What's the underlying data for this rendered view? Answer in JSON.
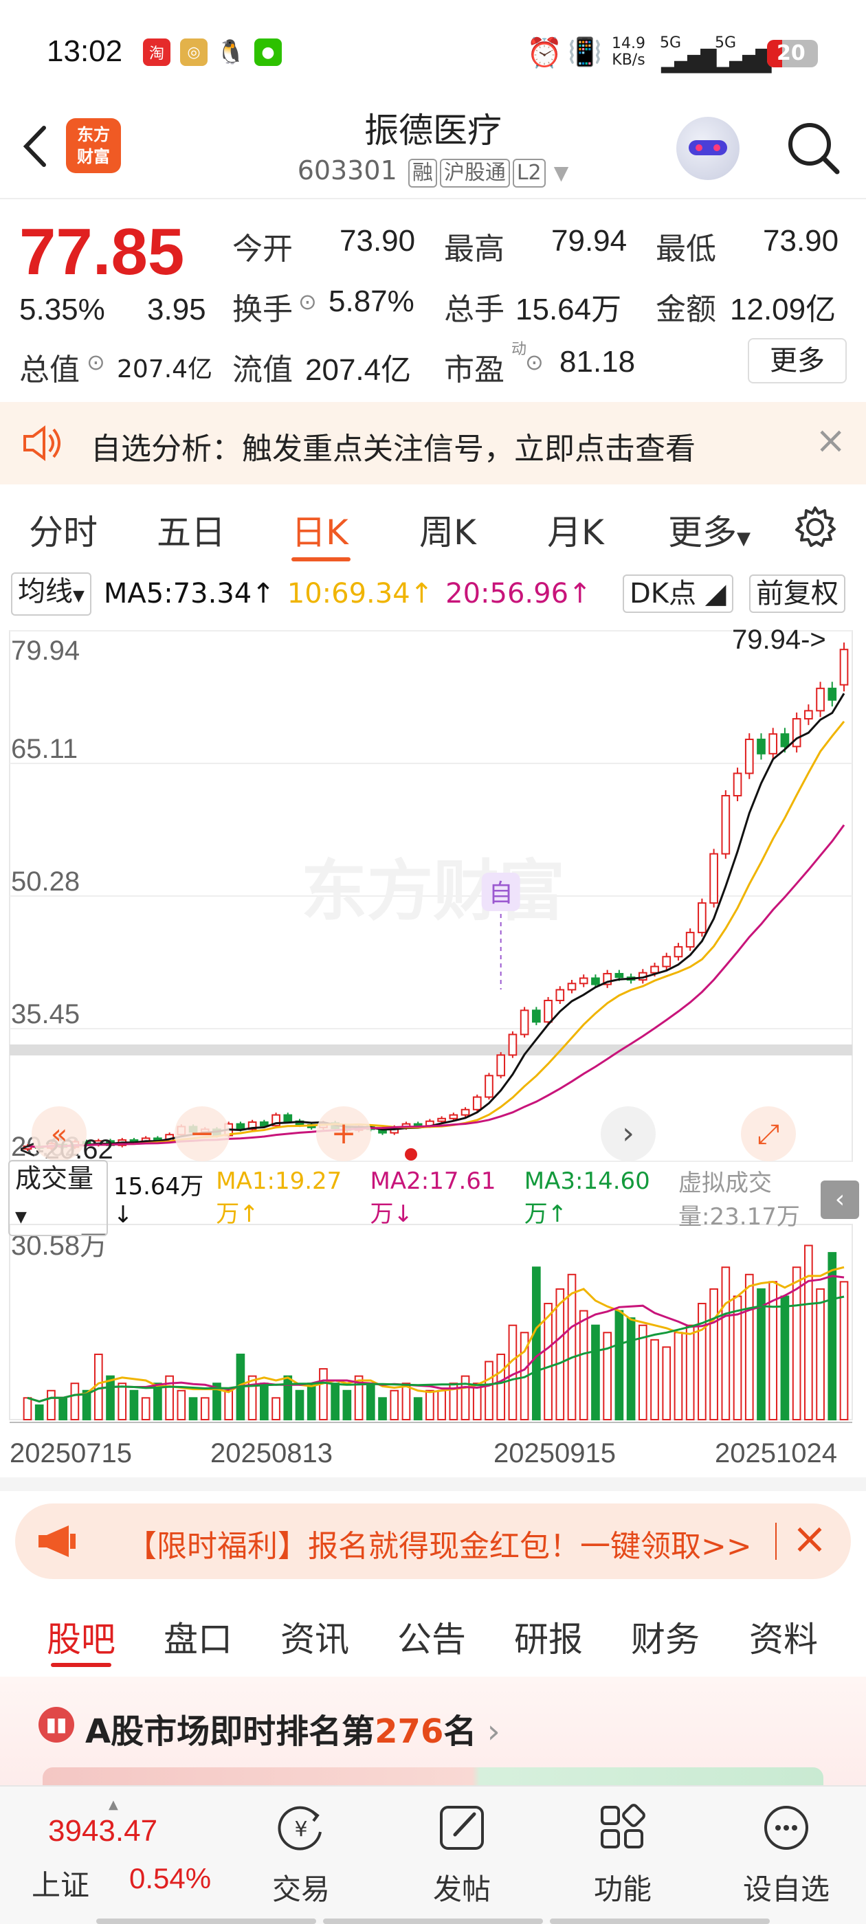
{
  "status_bar": {
    "time": "13:02",
    "net_speed": "14.9",
    "net_unit": "KB/s",
    "sig1": "5G",
    "sig2": "5G",
    "battery": "20"
  },
  "header": {
    "logo_text": "东方财富",
    "title": "振德医疗",
    "code": "603301",
    "tags": [
      "融",
      "沪股通",
      "L2"
    ]
  },
  "quote": {
    "price": "77.85",
    "change_pct": "5.35%",
    "change": "3.95",
    "fields": {
      "open_label": "今开",
      "open": "73.90",
      "high_label": "最高",
      "high": "79.94",
      "low_label": "最低",
      "low": "73.90",
      "turnover_label": "换手",
      "turnover": "5.87%",
      "volume_label": "总手",
      "volume": "15.64万",
      "amount_label": "金额",
      "amount": "12.09亿",
      "mktcap_label": "总值",
      "mktcap": "207.4亿",
      "float_label": "流值",
      "float": "207.4亿",
      "pe_label": "市盈",
      "pe_sup": "动",
      "pe": "81.18"
    },
    "more_label": "更多"
  },
  "alert": {
    "text": "自选分析：触发重点关注信号，立即点击查看"
  },
  "ktabs": [
    "分时",
    "五日",
    "日K",
    "周K",
    "月K",
    "更多"
  ],
  "ktab_active": 2,
  "ma_bar": {
    "ma_select": "均线",
    "ma5": "MA5:73.34",
    "ma10": "10:69.34",
    "ma20": "20:56.96",
    "dk": "DK点",
    "adjust": "前复权"
  },
  "colors": {
    "accent": "#f05a24",
    "up": "#e02020",
    "down": "#139a3c",
    "ma5": "#111111",
    "ma10": "#f0b400",
    "ma20": "#c8147a"
  },
  "chart_data": {
    "type": "candlestick",
    "y_ticks": [
      "79.94",
      "65.11",
      "50.28",
      "35.45",
      "20.62"
    ],
    "ylim": [
      20.62,
      79.94
    ],
    "high_marker": "79.94->",
    "low_marker": "<-20.62",
    "watermark": "东方财富",
    "zi_marker": "自",
    "x_labels": [
      "20250715",
      "20250813",
      "20250915",
      "20251024"
    ],
    "candles": [
      [
        22.0,
        22.3
      ],
      [
        22.3,
        22.1
      ],
      [
        22.1,
        22.6
      ],
      [
        22.5,
        22.2
      ],
      [
        22.2,
        22.8
      ],
      [
        22.8,
        22.5
      ],
      [
        22.5,
        22.9
      ],
      [
        22.9,
        22.4
      ],
      [
        22.4,
        23.0
      ],
      [
        23.0,
        22.8
      ],
      [
        22.8,
        23.2
      ],
      [
        23.2,
        22.9
      ],
      [
        22.9,
        23.6
      ],
      [
        23.6,
        24.5
      ],
      [
        24.5,
        23.9
      ],
      [
        23.9,
        24.2
      ],
      [
        24.2,
        23.5
      ],
      [
        23.5,
        24.8
      ],
      [
        24.8,
        24.2
      ],
      [
        24.2,
        25.0
      ],
      [
        25.0,
        24.6
      ],
      [
        24.6,
        25.8
      ],
      [
        25.8,
        25.1
      ],
      [
        25.1,
        24.7
      ],
      [
        24.7,
        24.4
      ],
      [
        24.4,
        24.9
      ],
      [
        24.9,
        24.3
      ],
      [
        24.3,
        24.1
      ],
      [
        24.1,
        24.5
      ],
      [
        24.5,
        24.2
      ],
      [
        24.2,
        23.8
      ],
      [
        23.8,
        24.4
      ],
      [
        24.4,
        24.8
      ],
      [
        24.8,
        24.6
      ],
      [
        24.6,
        25.1
      ],
      [
        25.1,
        25.4
      ],
      [
        25.4,
        25.8
      ],
      [
        25.8,
        26.4
      ],
      [
        26.4,
        27.8
      ],
      [
        27.8,
        30.2
      ],
      [
        30.2,
        32.5
      ],
      [
        32.5,
        34.8
      ],
      [
        34.8,
        37.5
      ],
      [
        37.5,
        36.2
      ],
      [
        36.2,
        38.6
      ],
      [
        38.6,
        39.8
      ],
      [
        39.8,
        40.5
      ],
      [
        40.5,
        41.1
      ],
      [
        41.1,
        40.4
      ],
      [
        40.4,
        41.6
      ],
      [
        41.6,
        41.2
      ],
      [
        41.2,
        40.9
      ],
      [
        40.9,
        41.7
      ],
      [
        41.7,
        42.4
      ],
      [
        42.4,
        43.5
      ],
      [
        43.5,
        44.6
      ],
      [
        44.6,
        46.2
      ],
      [
        46.2,
        49.5
      ],
      [
        49.5,
        55.0
      ],
      [
        55.0,
        61.5
      ],
      [
        61.5,
        64.0
      ],
      [
        64.0,
        67.8
      ],
      [
        67.8,
        66.2
      ],
      [
        66.2,
        68.4
      ],
      [
        68.4,
        67.0
      ],
      [
        67.0,
        70.1
      ],
      [
        70.1,
        71.0
      ],
      [
        71.0,
        73.5
      ],
      [
        73.5,
        72.2
      ],
      [
        73.9,
        77.85
      ]
    ],
    "volume": {
      "label": "成交量",
      "total": "15.64万",
      "ma1": "MA1:19.27万",
      "ma2": "MA2:17.61万",
      "ma3": "MA3:14.60万",
      "virtual": "虚拟成交量:23.17万",
      "ymax": "30.58万",
      "values": [
        3,
        2,
        4,
        3,
        5,
        4,
        9,
        6,
        5,
        4,
        3,
        5,
        6,
        4,
        3,
        3,
        5,
        4,
        9,
        6,
        5,
        3,
        6,
        4,
        5,
        7,
        5,
        4,
        6,
        5,
        3,
        4,
        5,
        3,
        4,
        4,
        5,
        6,
        5,
        8,
        9,
        13,
        12,
        21,
        16,
        18,
        20,
        15,
        13,
        12,
        15,
        14,
        13,
        11,
        10,
        12,
        13,
        16,
        18,
        21,
        17,
        20,
        18,
        19,
        17,
        21,
        24,
        18,
        23,
        19
      ]
    }
  },
  "promo": {
    "text": "【限时福利】报名就得现金红包！一键领取>>"
  },
  "btabs": [
    "股吧",
    "盘口",
    "资讯",
    "公告",
    "研报",
    "财务",
    "资料"
  ],
  "btab_active": 0,
  "rank": {
    "prefix": "A股市场即时排名第",
    "rank": "276",
    "suffix": "名"
  },
  "bottom_nav": {
    "index_value": "3943.47",
    "index_name": "上证",
    "index_pct": "0.54%",
    "items": [
      "交易",
      "发帖",
      "功能",
      "设自选"
    ]
  }
}
